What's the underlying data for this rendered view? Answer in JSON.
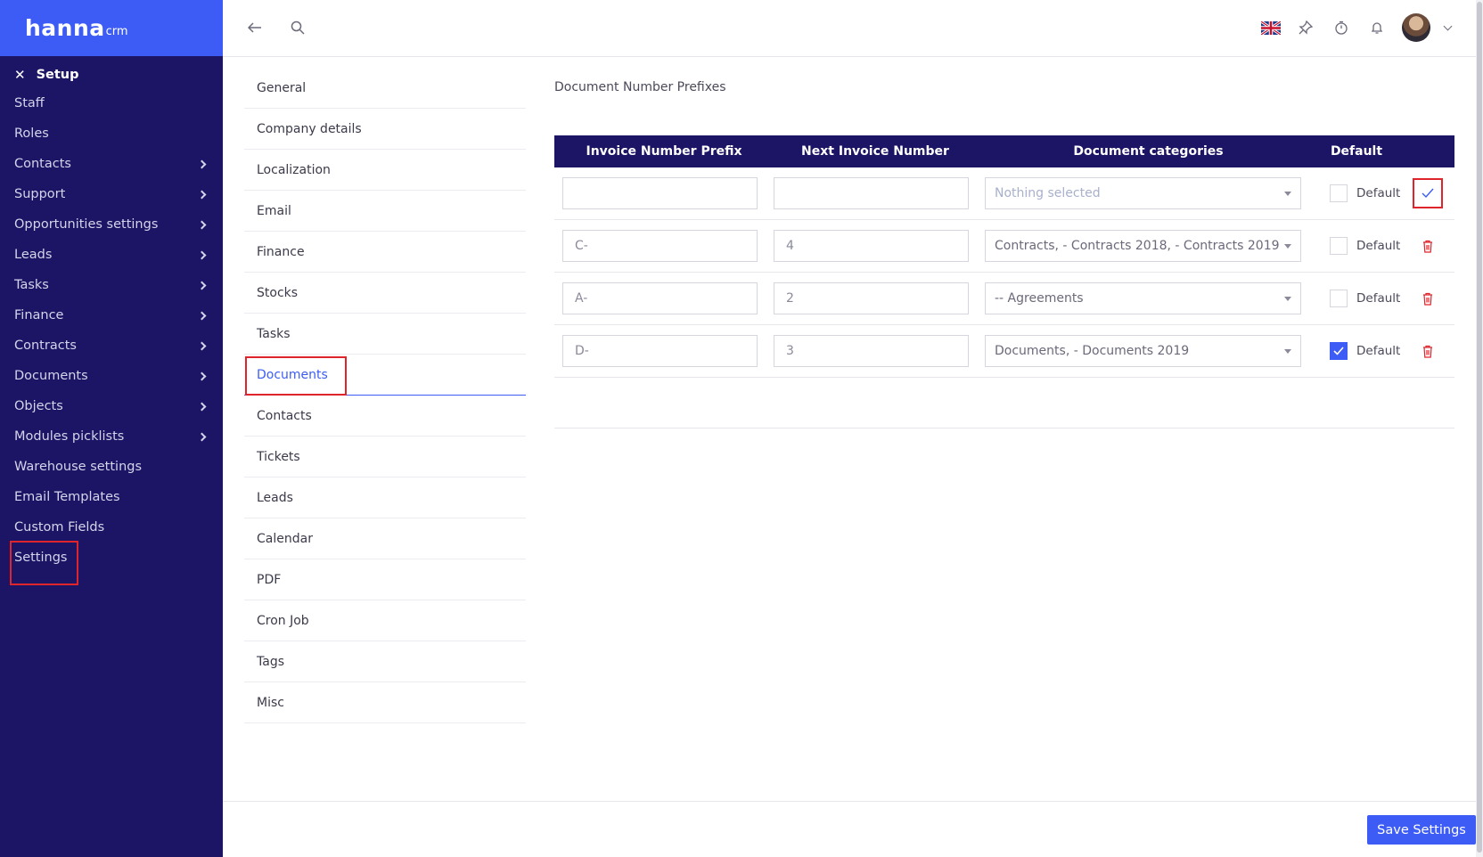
{
  "brand": {
    "name": "hanna",
    "suffix": "crm"
  },
  "sidebar": {
    "section_title": "Setup",
    "items": [
      {
        "label": "Staff",
        "has_children": false
      },
      {
        "label": "Roles",
        "has_children": false
      },
      {
        "label": "Contacts",
        "has_children": true
      },
      {
        "label": "Support",
        "has_children": true
      },
      {
        "label": "Opportunities settings",
        "has_children": true
      },
      {
        "label": "Leads",
        "has_children": true
      },
      {
        "label": "Tasks",
        "has_children": true
      },
      {
        "label": "Finance",
        "has_children": true
      },
      {
        "label": "Contracts",
        "has_children": true
      },
      {
        "label": "Documents",
        "has_children": true
      },
      {
        "label": "Objects",
        "has_children": true
      },
      {
        "label": "Modules picklists",
        "has_children": true
      },
      {
        "label": "Warehouse settings",
        "has_children": false
      },
      {
        "label": "Email Templates",
        "has_children": false
      },
      {
        "label": "Custom Fields",
        "has_children": false
      },
      {
        "label": "Settings",
        "has_children": false
      }
    ]
  },
  "settings_menu": {
    "items": [
      "General",
      "Company details",
      "Localization",
      "Email",
      "Finance",
      "Stocks",
      "Tasks",
      "Documents",
      "Contacts",
      "Tickets",
      "Leads",
      "Calendar",
      "PDF",
      "Cron Job",
      "Tags",
      "Misc"
    ],
    "active": "Documents"
  },
  "content": {
    "title": "Document Number Prefixes",
    "table": {
      "headers": [
        "Invoice Number Prefix",
        "Next Invoice Number",
        "Document categories",
        "Default"
      ],
      "new_row": {
        "prefix": "",
        "next_number": "",
        "categories": "Nothing selected",
        "default_label": "Default",
        "default_checked": false
      },
      "rows": [
        {
          "prefix": "C-",
          "next_number": "4",
          "categories": "Contracts, - Contracts 2018, - Contracts 2019",
          "default_label": "Default",
          "default_checked": false
        },
        {
          "prefix": "A-",
          "next_number": "2",
          "categories": "-- Agreements",
          "default_label": "Default",
          "default_checked": false
        },
        {
          "prefix": "D-",
          "next_number": "3",
          "categories": "Documents, - Documents 2019",
          "default_label": "Default",
          "default_checked": true
        }
      ]
    }
  },
  "footer": {
    "save_label": "Save Settings"
  },
  "colors": {
    "sidebar": "#1c1464",
    "brand": "#3d5cf5",
    "accent": "#3d5cf5",
    "danger": "#e0242c"
  }
}
